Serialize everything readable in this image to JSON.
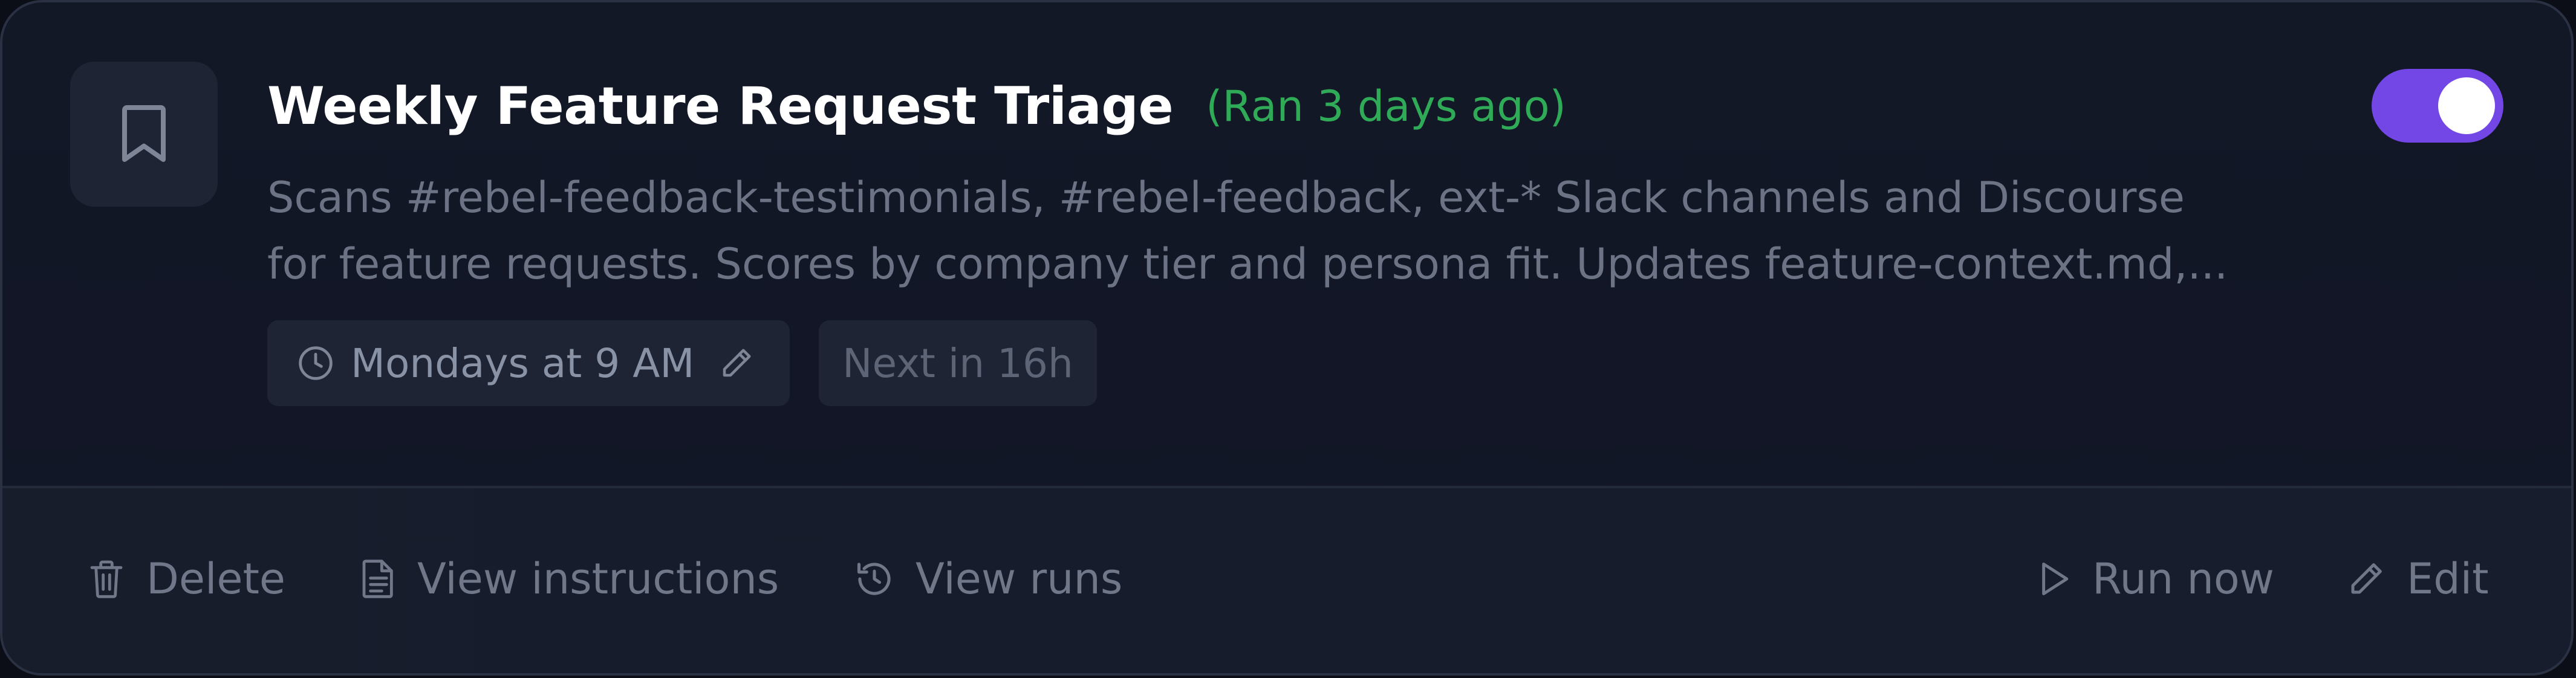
{
  "task": {
    "title": "Weekly Feature Request Triage",
    "last_run": "(Ran 3 days ago)",
    "enabled": true,
    "description_lines": [
      "Scans #rebel-feedback-testimonials, #rebel-feedback, ext-* Slack channels and Discourse",
      "for feature requests. Scores by company tier and persona fit. Updates feature-context.md,..."
    ],
    "schedule": "Mondays at 9 AM",
    "next_run": "Next in 16h",
    "icon": "bookmark-icon"
  },
  "actions": {
    "delete": "Delete",
    "view_instructions": "View instructions",
    "view_runs": "View runs",
    "run_now": "Run now",
    "edit": "Edit"
  },
  "colors": {
    "accent": "#7247e6",
    "success": "#2faa57",
    "card_bg": "#131827",
    "muted_text": "#6b7384"
  }
}
